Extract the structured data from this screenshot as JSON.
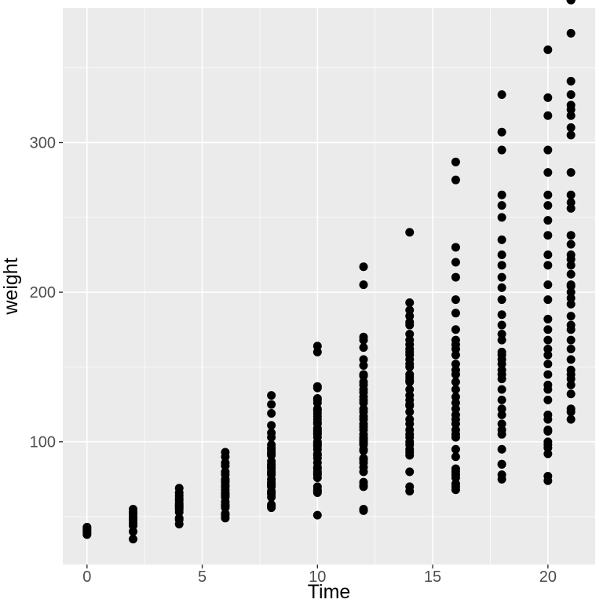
{
  "chart_data": {
    "type": "scatter",
    "xlabel": "Time",
    "ylabel": "weight",
    "xlim": [
      -1.05,
      22.05
    ],
    "ylim": [
      18,
      390
    ],
    "x_major_ticks": [
      0,
      5,
      10,
      15,
      20
    ],
    "y_major_ticks": [
      100,
      200,
      300
    ],
    "x_minor_ticks": [
      2.5,
      7.5,
      12.5,
      17.5
    ],
    "y_minor_ticks": [
      50,
      150,
      250,
      350
    ],
    "point_radius": 5.5,
    "point_fill": "#000000",
    "series": [
      {
        "name": "weight",
        "x": [
          0,
          0,
          0,
          0,
          0,
          0,
          2,
          2,
          2,
          2,
          2,
          2,
          2,
          2,
          2,
          2,
          4,
          4,
          4,
          4,
          4,
          4,
          4,
          4,
          4,
          4,
          4,
          4,
          4,
          4,
          6,
          6,
          6,
          6,
          6,
          6,
          6,
          6,
          6,
          6,
          6,
          6,
          6,
          6,
          6,
          6,
          6,
          6,
          6,
          6,
          6,
          6,
          6,
          8,
          8,
          8,
          8,
          8,
          8,
          8,
          8,
          8,
          8,
          8,
          8,
          8,
          8,
          8,
          8,
          8,
          8,
          8,
          8,
          8,
          8,
          8,
          8,
          8,
          8,
          8,
          8,
          8,
          8,
          8,
          8,
          10,
          10,
          10,
          10,
          10,
          10,
          10,
          10,
          10,
          10,
          10,
          10,
          10,
          10,
          10,
          10,
          10,
          10,
          10,
          10,
          10,
          10,
          10,
          10,
          10,
          10,
          10,
          10,
          10,
          10,
          10,
          10,
          10,
          10,
          10,
          10,
          10,
          10,
          10,
          10,
          12,
          12,
          12,
          12,
          12,
          12,
          12,
          12,
          12,
          12,
          12,
          12,
          12,
          12,
          12,
          12,
          12,
          12,
          12,
          12,
          12,
          12,
          12,
          12,
          12,
          12,
          12,
          12,
          12,
          12,
          12,
          12,
          12,
          12,
          12,
          12,
          12,
          12,
          12,
          12,
          12,
          12,
          14,
          14,
          14,
          14,
          14,
          14,
          14,
          14,
          14,
          14,
          14,
          14,
          14,
          14,
          14,
          14,
          14,
          14,
          14,
          14,
          14,
          14,
          14,
          14,
          14,
          14,
          14,
          14,
          14,
          14,
          14,
          14,
          14,
          14,
          14,
          14,
          14,
          14,
          16,
          16,
          16,
          16,
          16,
          16,
          16,
          16,
          16,
          16,
          16,
          16,
          16,
          16,
          16,
          16,
          16,
          16,
          16,
          16,
          16,
          16,
          16,
          16,
          16,
          16,
          16,
          16,
          16,
          16,
          16,
          16,
          16,
          16,
          16,
          18,
          18,
          18,
          18,
          18,
          18,
          18,
          18,
          18,
          18,
          18,
          18,
          18,
          18,
          18,
          18,
          18,
          18,
          18,
          18,
          18,
          18,
          18,
          18,
          18,
          18,
          18,
          18,
          18,
          18,
          18,
          18,
          18,
          18,
          18,
          20,
          20,
          20,
          20,
          20,
          20,
          20,
          20,
          20,
          20,
          20,
          20,
          20,
          20,
          20,
          20,
          20,
          20,
          20,
          20,
          20,
          20,
          20,
          20,
          20,
          20,
          20,
          20,
          20,
          20,
          20,
          20,
          20,
          21,
          21,
          21,
          21,
          21,
          21,
          21,
          21,
          21,
          21,
          21,
          21,
          21,
          21,
          21,
          21,
          21,
          21,
          21,
          21,
          21,
          21,
          21,
          21,
          21,
          21,
          21,
          21,
          21,
          21,
          21,
          21,
          21,
          21,
          21,
          21,
          21,
          21,
          21,
          21,
          21,
          21,
          21
        ],
        "values": [
          38,
          39,
          40,
          41,
          42,
          43,
          35,
          40,
          44,
          46,
          48,
          49,
          50,
          52,
          53,
          55,
          45,
          48,
          49,
          53,
          55,
          56,
          57,
          58,
          59,
          61,
          62,
          64,
          66,
          69,
          49,
          51,
          52,
          56,
          57,
          58,
          60,
          63,
          64,
          65,
          66,
          68,
          70,
          71,
          73,
          74,
          75,
          78,
          80,
          84,
          86,
          90,
          93,
          56,
          57,
          58,
          63,
          65,
          66,
          67,
          70,
          71,
          72,
          73,
          75,
          78,
          79,
          80,
          82,
          83,
          84,
          85,
          87,
          91,
          92,
          93,
          95,
          96,
          98,
          103,
          106,
          111,
          119,
          125,
          131,
          51,
          66,
          67,
          68,
          70,
          76,
          78,
          79,
          80,
          82,
          83,
          86,
          89,
          91,
          92,
          95,
          97,
          98,
          99,
          100,
          103,
          105,
          106,
          107,
          108,
          109,
          112,
          113,
          115,
          117,
          119,
          121,
          122,
          126,
          128,
          129,
          136,
          137,
          160,
          164,
          54,
          70,
          71,
          73,
          80,
          83,
          86,
          88,
          89,
          94,
          95,
          98,
          99,
          100,
          101,
          102,
          103,
          105,
          108,
          110,
          112,
          115,
          117,
          120,
          122,
          126,
          128,
          130,
          133,
          135,
          138,
          140,
          144,
          145,
          151,
          155,
          163,
          168,
          170,
          205,
          217,
          55,
          67,
          70,
          80,
          91,
          93,
          95,
          98,
          100,
          103,
          105,
          108,
          112,
          115,
          120,
          124,
          125,
          128,
          131,
          135,
          140,
          141,
          143,
          145,
          150,
          152,
          155,
          158,
          160,
          162,
          165,
          168,
          172,
          178,
          180,
          184,
          188,
          193,
          240,
          68,
          70,
          78,
          80,
          90,
          95,
          103,
          105,
          108,
          112,
          115,
          118,
          122,
          126,
          130,
          135,
          140,
          145,
          148,
          152,
          158,
          162,
          165,
          168,
          175,
          186,
          195,
          210,
          220,
          230,
          275,
          287,
          72,
          76,
          82,
          85,
          95,
          105,
          108,
          112,
          118,
          122,
          128,
          135,
          142,
          145,
          148,
          152,
          155,
          158,
          160,
          168,
          172,
          178,
          185,
          195,
          203,
          210,
          218,
          225,
          235,
          250,
          258,
          265,
          295,
          307,
          332,
          75,
          78,
          85,
          92,
          100,
          108,
          115,
          118,
          128,
          135,
          138,
          145,
          152,
          158,
          162,
          168,
          175,
          182,
          195,
          205,
          218,
          225,
          238,
          248,
          258,
          265,
          280,
          295,
          318,
          330,
          362,
          74,
          77,
          96,
          98,
          107,
          115,
          120,
          122,
          132,
          138,
          142,
          145,
          148,
          155,
          162,
          168,
          175,
          178,
          184,
          192,
          196,
          200,
          204,
          205,
          212,
          218,
          222,
          225,
          232,
          238,
          256,
          260,
          265,
          280,
          305,
          310,
          318,
          322,
          325,
          332,
          341,
          373
        ]
      }
    ]
  }
}
